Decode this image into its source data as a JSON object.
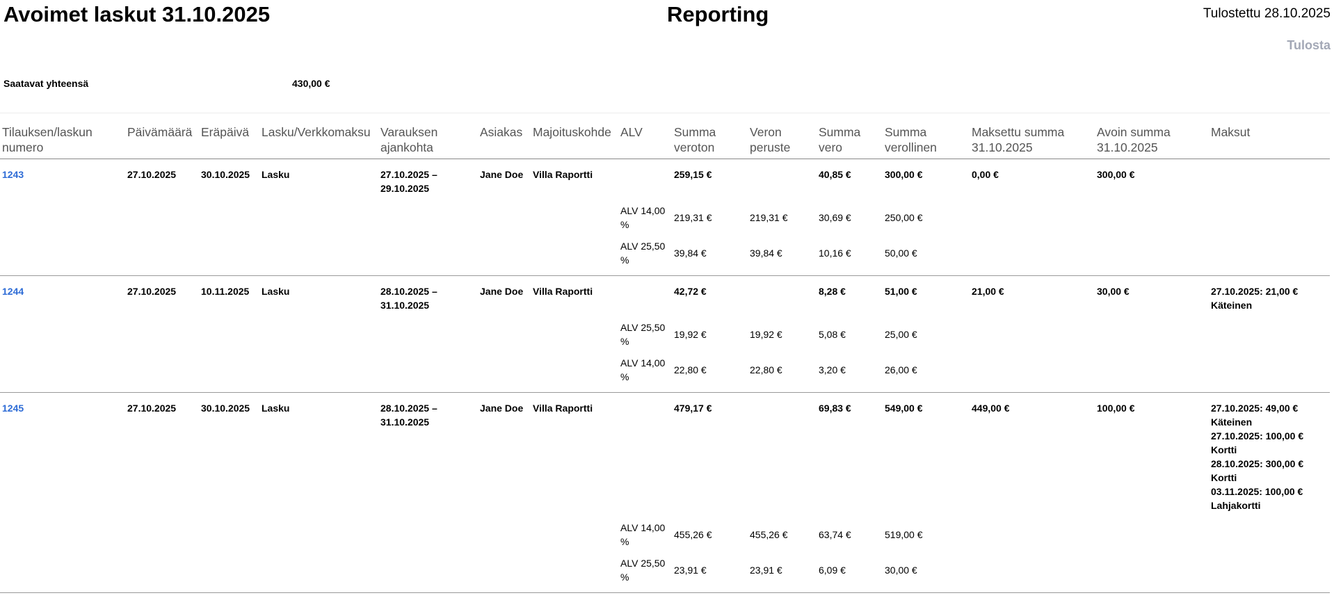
{
  "header": {
    "title": "Avoimet laskut 31.10.2025",
    "center_title": "Reporting",
    "printed": "Tulostettu 28.10.2025",
    "print_label": "Tulosta"
  },
  "summary": {
    "label": "Saatavat yhteensä",
    "value": "430,00 €"
  },
  "columns": [
    "Tilauksen/laskun numero",
    "Päivämäärä",
    "Eräpäivä",
    "Lasku/Verkkomaksu",
    "Varauksen ajankohta",
    "Asiakas",
    "Majoituskohde",
    "ALV",
    "Summa veroton",
    "Veron peruste",
    "Summa vero",
    "Summa verollinen",
    "Maksettu summa 31.10.2025",
    "Avoin summa 31.10.2025",
    "Maksut"
  ],
  "invoices": [
    {
      "number": "1243",
      "date": "27.10.2025",
      "due": "30.10.2025",
      "type": "Lasku",
      "period": "27.10.2025 – 29.10.2025",
      "customer": "Jane Doe",
      "property": "Villa Raportti",
      "net": "259,15 €",
      "tax": "40,85 €",
      "gross": "300,00 €",
      "paid": "0,00 €",
      "open": "300,00 €",
      "payments": [],
      "vat_rows": [
        {
          "rate": "ALV 14,00 %",
          "net": "219,31 €",
          "base": "219,31 €",
          "tax": "30,69 €",
          "gross": "250,00 €"
        },
        {
          "rate": "ALV 25,50 %",
          "net": "39,84 €",
          "base": "39,84 €",
          "tax": "10,16 €",
          "gross": "50,00 €"
        }
      ]
    },
    {
      "number": "1244",
      "date": "27.10.2025",
      "due": "10.11.2025",
      "type": "Lasku",
      "period": "28.10.2025 – 31.10.2025",
      "customer": "Jane Doe",
      "property": "Villa Raportti",
      "net": "42,72 €",
      "tax": "8,28 €",
      "gross": "51,00 €",
      "paid": "21,00 €",
      "open": "30,00 €",
      "payments": [
        "27.10.2025: 21,00 €",
        "Käteinen"
      ],
      "vat_rows": [
        {
          "rate": "ALV 25,50 %",
          "net": "19,92 €",
          "base": "19,92 €",
          "tax": "5,08 €",
          "gross": "25,00 €"
        },
        {
          "rate": "ALV 14,00 %",
          "net": "22,80 €",
          "base": "22,80 €",
          "tax": "3,20 €",
          "gross": "26,00 €"
        }
      ]
    },
    {
      "number": "1245",
      "date": "27.10.2025",
      "due": "30.10.2025",
      "type": "Lasku",
      "period": "28.10.2025 – 31.10.2025",
      "customer": "Jane Doe",
      "property": "Villa Raportti",
      "net": "479,17 €",
      "tax": "69,83 €",
      "gross": "549,00 €",
      "paid": "449,00 €",
      "open": "100,00 €",
      "payments": [
        "27.10.2025: 49,00 €",
        "Käteinen",
        "27.10.2025: 100,00 €",
        "Kortti",
        "28.10.2025: 300,00 €",
        "Kortti",
        "03.11.2025: 100,00 €",
        "Lahjakortti"
      ],
      "vat_rows": [
        {
          "rate": "ALV 14,00 %",
          "net": "455,26 €",
          "base": "455,26 €",
          "tax": "63,74 €",
          "gross": "519,00 €"
        },
        {
          "rate": "ALV 25,50 %",
          "net": "23,91 €",
          "base": "23,91 €",
          "tax": "6,09 €",
          "gross": "30,00 €"
        }
      ]
    }
  ],
  "colors": {
    "link": "#2e6cd6",
    "print_button": "#a3a8b6",
    "header_text": "#555555"
  }
}
